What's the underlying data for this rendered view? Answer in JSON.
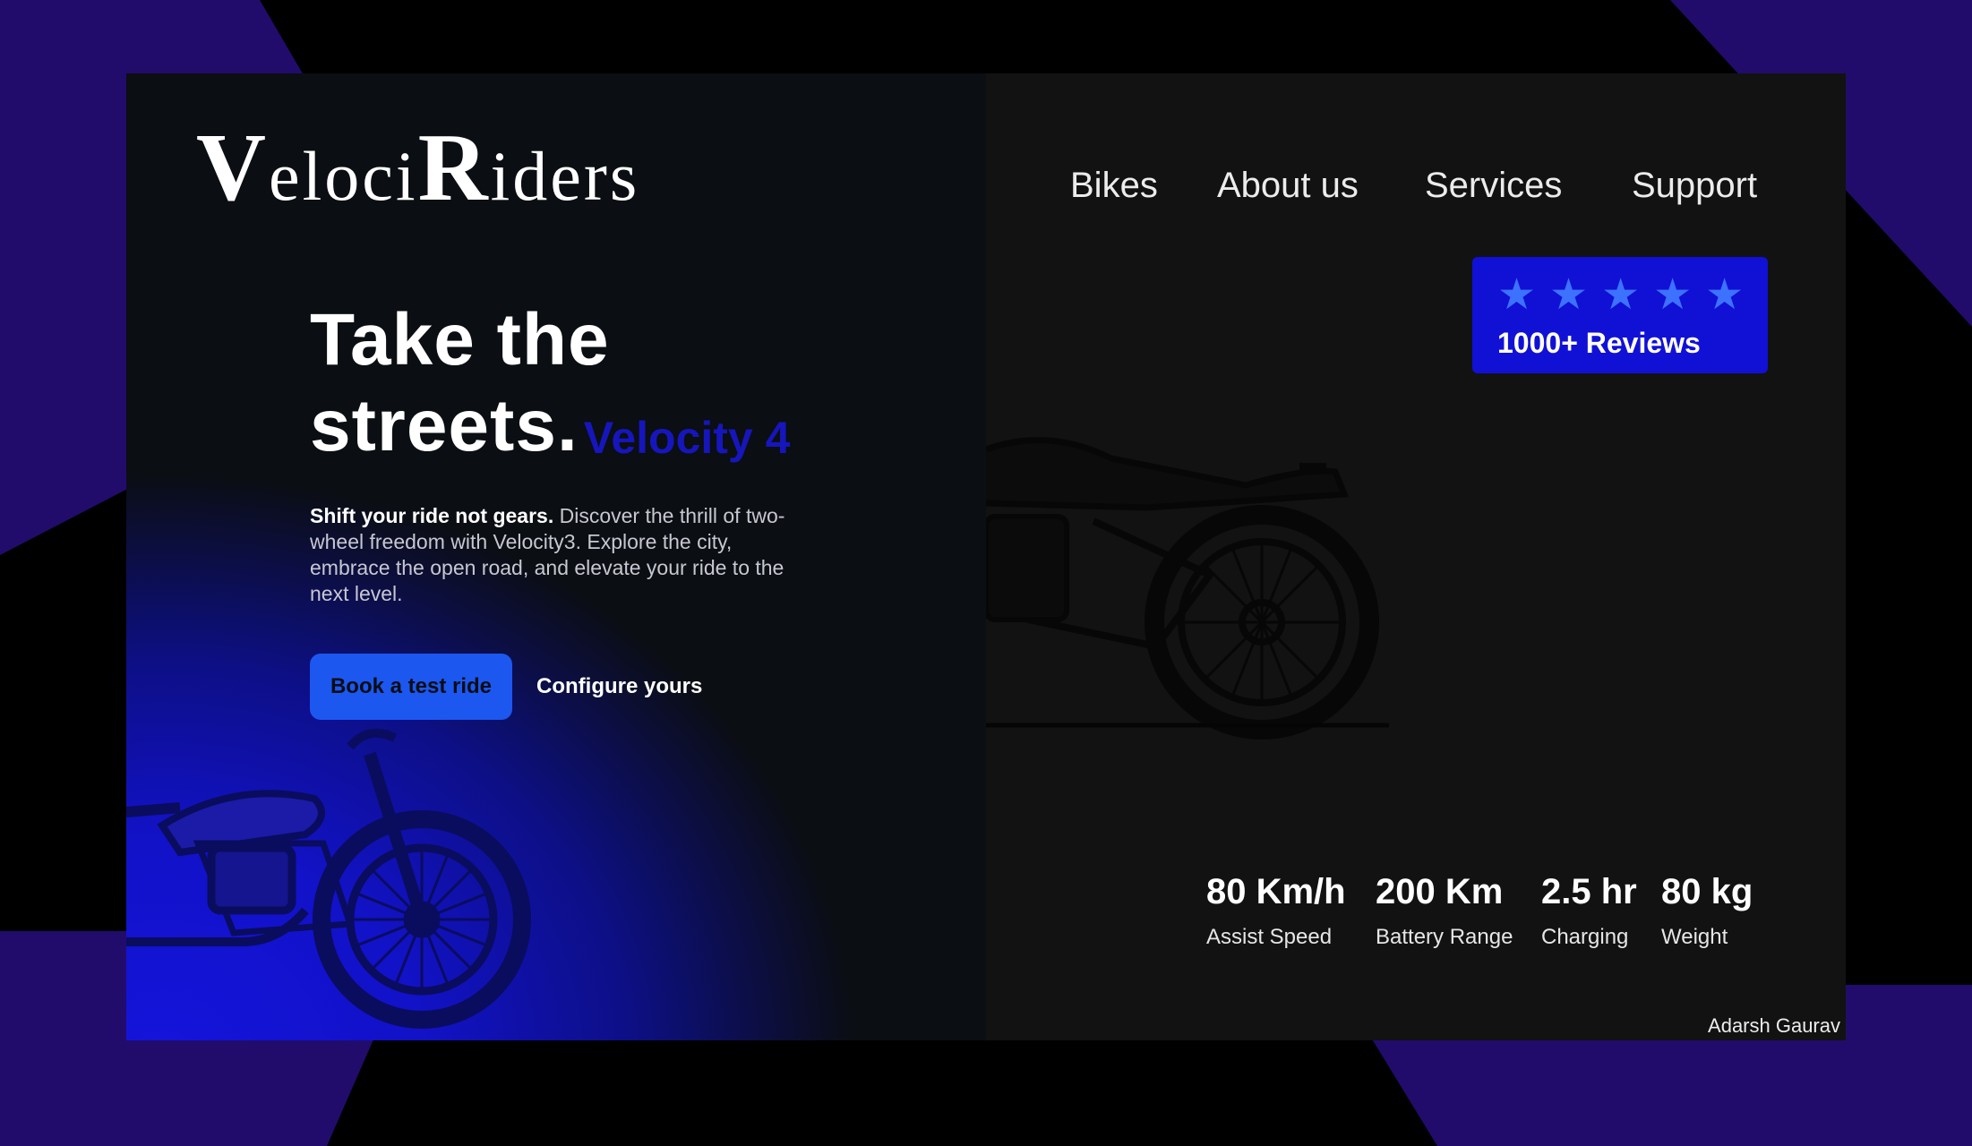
{
  "brand": {
    "logo_text": "VelociRiders",
    "logo_parts": [
      "V",
      "eloci",
      "R",
      "iders"
    ]
  },
  "nav": {
    "items": [
      "Bikes",
      "About us",
      "Services",
      "Support"
    ]
  },
  "hero": {
    "headline_line1": "Take the",
    "headline_line2": "streets.",
    "model_name": "Velocity 4",
    "description_bold": "Shift your ride not gears.",
    "description_rest": " Discover the thrill of two-wheel freedom with Velocity3. Explore the city, embrace the open road, and elevate your ride to the next level.",
    "primary_button": "Book a test ride",
    "secondary_link": "Configure yours"
  },
  "reviews": {
    "rating": 5,
    "max_rating": 5,
    "stars": [
      "★",
      "★",
      "★",
      "★",
      "★"
    ],
    "label": "1000+ Reviews"
  },
  "specs": [
    {
      "value": "80 Km/h",
      "label": "Assist Speed"
    },
    {
      "value": "200 Km",
      "label": "Battery Range"
    },
    {
      "value": "2.5 hr",
      "label": "Charging"
    },
    {
      "value": "80 kg",
      "label": "Weight"
    }
  ],
  "footer": {
    "author": "Adarsh Gaurav"
  },
  "icons": {
    "review_star": "star-icon",
    "left_image": "motorcycle-image",
    "right_image": "motorcycle-image"
  },
  "colors": {
    "outer_background": "#000000",
    "decorative_purple": "#210c6b",
    "card_left_background": "#0b0e12",
    "card_right_background": "#121212",
    "gradient_blue": "#1414dc",
    "model_text": "#1616bc",
    "primary_button": "#1c57f0",
    "review_badge": "#1111d6",
    "star": "#3d71ff",
    "text_primary": "#ffffff"
  }
}
